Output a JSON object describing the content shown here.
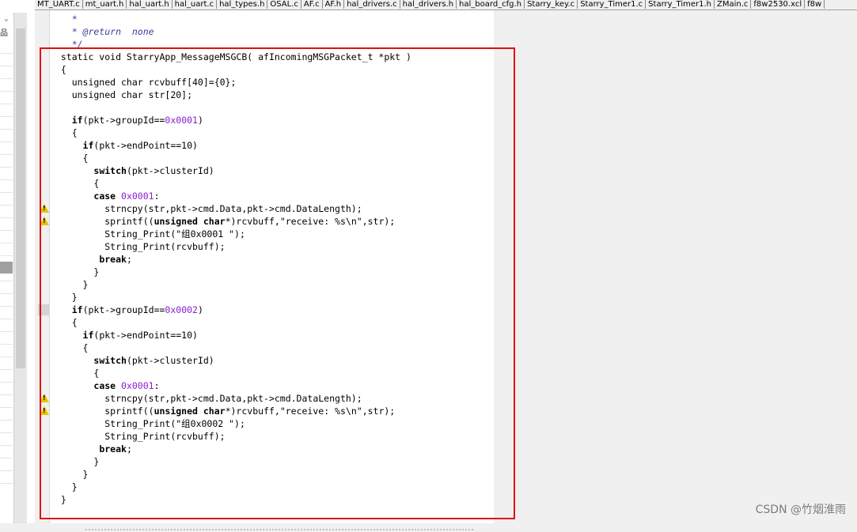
{
  "tabs": [
    "MT_UART.c",
    "mt_uart.h",
    "hal_uart.h",
    "hal_uart.c",
    "hal_types.h",
    "OSAL.c",
    "AF.c",
    "AF.h",
    "hal_drivers.c",
    "hal_drivers.h",
    "hal_board_cfg.h",
    "Starry_key.c",
    "Starry_Timer1.c",
    "Starry_Timer1.h",
    "ZMain.c",
    "f8w2530.xcl",
    "f8w"
  ],
  "left_panel": {
    "collapse": "⌄",
    "icon": "品"
  },
  "code_lines": [
    {
      "tokens": [
        {
          "t": "    *",
          "c": "cm"
        }
      ]
    },
    {
      "tokens": [
        {
          "t": "    * @return  none",
          "c": "cm"
        }
      ]
    },
    {
      "tokens": [
        {
          "t": "    */",
          "c": "cm"
        }
      ]
    },
    {
      "tokens": [
        {
          "t": "  static void StarryApp_MessageMSGCB( afIncomingMSGPacket_t *pkt )",
          "c": ""
        }
      ]
    },
    {
      "tokens": [
        {
          "t": "  {",
          "c": ""
        }
      ]
    },
    {
      "tokens": [
        {
          "t": "    unsigned char rcvbuff[40]={0};",
          "c": ""
        }
      ]
    },
    {
      "tokens": [
        {
          "t": "    unsigned char str[20];",
          "c": ""
        }
      ]
    },
    {
      "tokens": [
        {
          "t": "",
          "c": ""
        }
      ]
    },
    {
      "tokens": [
        {
          "t": "    ",
          "c": ""
        },
        {
          "t": "if",
          "c": "kw"
        },
        {
          "t": "(pkt->groupId==",
          "c": ""
        },
        {
          "t": "0x0001",
          "c": "hx"
        },
        {
          "t": ")",
          "c": ""
        }
      ]
    },
    {
      "tokens": [
        {
          "t": "    {",
          "c": ""
        }
      ]
    },
    {
      "tokens": [
        {
          "t": "      ",
          "c": ""
        },
        {
          "t": "if",
          "c": "kw"
        },
        {
          "t": "(pkt->endPoint==10)",
          "c": ""
        }
      ]
    },
    {
      "tokens": [
        {
          "t": "      {",
          "c": ""
        }
      ]
    },
    {
      "tokens": [
        {
          "t": "        ",
          "c": ""
        },
        {
          "t": "switch",
          "c": "kw"
        },
        {
          "t": "(pkt->clusterId)",
          "c": ""
        }
      ]
    },
    {
      "tokens": [
        {
          "t": "        {",
          "c": ""
        }
      ]
    },
    {
      "tokens": [
        {
          "t": "        ",
          "c": ""
        },
        {
          "t": "case",
          "c": "kw"
        },
        {
          "t": " ",
          "c": ""
        },
        {
          "t": "0x0001",
          "c": "hx"
        },
        {
          "t": ":",
          "c": ""
        }
      ]
    },
    {
      "tokens": [
        {
          "t": "          strncpy(str,pkt->cmd.Data,pkt->cmd.DataLength);",
          "c": ""
        }
      ]
    },
    {
      "tokens": [
        {
          "t": "          sprintf((",
          "c": ""
        },
        {
          "t": "unsigned char",
          "c": "kw"
        },
        {
          "t": "*)rcvbuff,\"receive: %s\\n\",str);",
          "c": ""
        }
      ]
    },
    {
      "tokens": [
        {
          "t": "          String_Print(\"组0x0001 \");",
          "c": ""
        }
      ]
    },
    {
      "tokens": [
        {
          "t": "          String_Print(rcvbuff);",
          "c": ""
        }
      ]
    },
    {
      "tokens": [
        {
          "t": "         ",
          "c": ""
        },
        {
          "t": "break",
          "c": "kw"
        },
        {
          "t": ";",
          "c": ""
        }
      ]
    },
    {
      "tokens": [
        {
          "t": "        }",
          "c": ""
        }
      ]
    },
    {
      "tokens": [
        {
          "t": "      }",
          "c": ""
        }
      ]
    },
    {
      "tokens": [
        {
          "t": "    }",
          "c": ""
        }
      ]
    },
    {
      "tokens": [
        {
          "t": "    ",
          "c": ""
        },
        {
          "t": "if",
          "c": "kw"
        },
        {
          "t": "(pkt->groupId==",
          "c": ""
        },
        {
          "t": "0x0002",
          "c": "hx"
        },
        {
          "t": ")",
          "c": ""
        }
      ]
    },
    {
      "tokens": [
        {
          "t": "    {",
          "c": ""
        }
      ]
    },
    {
      "tokens": [
        {
          "t": "      ",
          "c": ""
        },
        {
          "t": "if",
          "c": "kw"
        },
        {
          "t": "(pkt->endPoint==10)",
          "c": ""
        }
      ]
    },
    {
      "tokens": [
        {
          "t": "      {",
          "c": ""
        }
      ]
    },
    {
      "tokens": [
        {
          "t": "        ",
          "c": ""
        },
        {
          "t": "switch",
          "c": "kw"
        },
        {
          "t": "(pkt->clusterId)",
          "c": ""
        }
      ]
    },
    {
      "tokens": [
        {
          "t": "        {",
          "c": ""
        }
      ]
    },
    {
      "tokens": [
        {
          "t": "        ",
          "c": ""
        },
        {
          "t": "case",
          "c": "kw"
        },
        {
          "t": " ",
          "c": ""
        },
        {
          "t": "0x0001",
          "c": "hx"
        },
        {
          "t": ":",
          "c": ""
        }
      ]
    },
    {
      "tokens": [
        {
          "t": "          strncpy(str,pkt->cmd.Data,pkt->cmd.DataLength);",
          "c": ""
        }
      ]
    },
    {
      "tokens": [
        {
          "t": "          sprintf((",
          "c": ""
        },
        {
          "t": "unsigned char",
          "c": "kw"
        },
        {
          "t": "*)rcvbuff,\"receive: %s\\n\",str);",
          "c": ""
        }
      ]
    },
    {
      "tokens": [
        {
          "t": "          String_Print(\"组0x0002 \");",
          "c": ""
        }
      ]
    },
    {
      "tokens": [
        {
          "t": "          String_Print(rcvbuff);",
          "c": ""
        }
      ]
    },
    {
      "tokens": [
        {
          "t": "         ",
          "c": ""
        },
        {
          "t": "break",
          "c": "kw"
        },
        {
          "t": ";",
          "c": ""
        }
      ]
    },
    {
      "tokens": [
        {
          "t": "        }",
          "c": ""
        }
      ]
    },
    {
      "tokens": [
        {
          "t": "      }",
          "c": ""
        }
      ]
    },
    {
      "tokens": [
        {
          "t": "    }",
          "c": ""
        }
      ]
    },
    {
      "tokens": [
        {
          "t": "  }",
          "c": ""
        }
      ]
    }
  ],
  "warning_line_indices": [
    15,
    16,
    30,
    31
  ],
  "bookmark_line_indices": [
    23
  ],
  "watermark": "CSDN @竹烟淮雨",
  "colors": {
    "highlight_box": "#e01010",
    "hex_literal": "#8c1cd0",
    "comment": "#3c3c9c",
    "warning": "#e8c400"
  }
}
